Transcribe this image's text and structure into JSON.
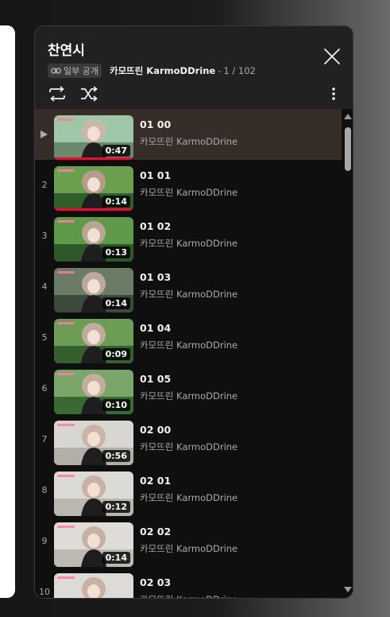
{
  "playlist": {
    "title": "찬연시",
    "visibility": "일부 공개",
    "owner": "카모뜨린 KarmoDDrine",
    "separator": "-",
    "position": "1 / 102"
  },
  "icons": {
    "close": "close-icon",
    "loop": "loop-icon",
    "shuffle": "shuffle-icon",
    "more": "more-vert-icon",
    "link": "link-icon"
  },
  "colors": {
    "panel_bg": "#0f0f0f",
    "header_bg": "#212121",
    "active_row": "#372d28",
    "progress": "#ff0033"
  },
  "videos": [
    {
      "index": "",
      "title": "01 00",
      "channel": "카모뜨린 KarmoDDrine",
      "duration": "0:47",
      "active": true,
      "watched": 1.0
    },
    {
      "index": "2",
      "title": "01 01",
      "channel": "카모뜨린 KarmoDDrine",
      "duration": "0:14",
      "active": false,
      "watched": 1.0
    },
    {
      "index": "3",
      "title": "01 02",
      "channel": "카모뜨린 KarmoDDrine",
      "duration": "0:13",
      "active": false,
      "watched": 0
    },
    {
      "index": "4",
      "title": "01 03",
      "channel": "카모뜨린 KarmoDDrine",
      "duration": "0:14",
      "active": false,
      "watched": 0
    },
    {
      "index": "5",
      "title": "01 04",
      "channel": "카모뜨린 KarmoDDrine",
      "duration": "0:09",
      "active": false,
      "watched": 0
    },
    {
      "index": "6",
      "title": "01 05",
      "channel": "카모뜨린 KarmoDDrine",
      "duration": "0:10",
      "active": false,
      "watched": 0
    },
    {
      "index": "7",
      "title": "02 00",
      "channel": "카모뜨린 KarmoDDrine",
      "duration": "0:56",
      "active": false,
      "watched": 0
    },
    {
      "index": "8",
      "title": "02 01",
      "channel": "카모뜨린 KarmoDDrine",
      "duration": "0:12",
      "active": false,
      "watched": 0
    },
    {
      "index": "9",
      "title": "02 02",
      "channel": "카모뜨린 KarmoDDrine",
      "duration": "0:14",
      "active": false,
      "watched": 0
    },
    {
      "index": "10",
      "title": "02 03",
      "channel": "카모뜨린 KarmoDDrine",
      "duration": "",
      "active": false,
      "watched": 0
    }
  ]
}
